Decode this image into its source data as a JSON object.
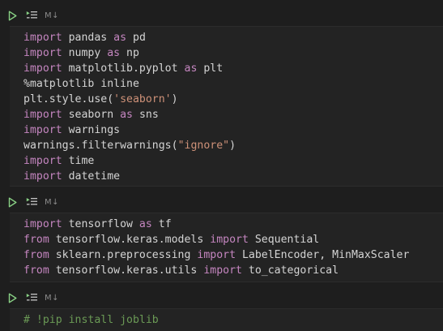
{
  "toolbar": {
    "markdown_label": "M↓"
  },
  "cells": [
    {
      "lines": [
        [
          {
            "k": "kw",
            "t": "import"
          },
          {
            "k": "tx",
            "t": " pandas "
          },
          {
            "k": "kw",
            "t": "as"
          },
          {
            "k": "tx",
            "t": " pd"
          }
        ],
        [
          {
            "k": "kw",
            "t": "import"
          },
          {
            "k": "tx",
            "t": " numpy "
          },
          {
            "k": "kw",
            "t": "as"
          },
          {
            "k": "tx",
            "t": " np"
          }
        ],
        [
          {
            "k": "kw",
            "t": "import"
          },
          {
            "k": "tx",
            "t": " matplotlib.pyplot "
          },
          {
            "k": "kw",
            "t": "as"
          },
          {
            "k": "tx",
            "t": " plt"
          }
        ],
        [
          {
            "k": "tx",
            "t": "%matplotlib inline"
          }
        ],
        [
          {
            "k": "tx",
            "t": "plt.style.use("
          },
          {
            "k": "str",
            "t": "'seaborn'"
          },
          {
            "k": "tx",
            "t": ")"
          }
        ],
        [
          {
            "k": "kw",
            "t": "import"
          },
          {
            "k": "tx",
            "t": " seaborn "
          },
          {
            "k": "kw",
            "t": "as"
          },
          {
            "k": "tx",
            "t": " sns"
          }
        ],
        [
          {
            "k": "kw",
            "t": "import"
          },
          {
            "k": "tx",
            "t": " warnings"
          }
        ],
        [
          {
            "k": "tx",
            "t": "warnings.filterwarnings("
          },
          {
            "k": "str",
            "t": "\"ignore\""
          },
          {
            "k": "tx",
            "t": ")"
          }
        ],
        [
          {
            "k": "kw",
            "t": "import"
          },
          {
            "k": "tx",
            "t": " time"
          }
        ],
        [
          {
            "k": "kw",
            "t": "import"
          },
          {
            "k": "tx",
            "t": " datetime"
          }
        ]
      ]
    },
    {
      "lines": [
        [
          {
            "k": "kw",
            "t": "import"
          },
          {
            "k": "tx",
            "t": " tensorflow "
          },
          {
            "k": "kw",
            "t": "as"
          },
          {
            "k": "tx",
            "t": " tf"
          }
        ],
        [
          {
            "k": "kw",
            "t": "from"
          },
          {
            "k": "tx",
            "t": " tensorflow.keras.models "
          },
          {
            "k": "kw",
            "t": "import"
          },
          {
            "k": "tx",
            "t": " Sequential"
          }
        ],
        [
          {
            "k": "kw",
            "t": "from"
          },
          {
            "k": "tx",
            "t": " sklearn.preprocessing "
          },
          {
            "k": "kw",
            "t": "import"
          },
          {
            "k": "tx",
            "t": " LabelEncoder, MinMaxScaler"
          }
        ],
        [
          {
            "k": "kw",
            "t": "from"
          },
          {
            "k": "tx",
            "t": " tensorflow.keras.utils "
          },
          {
            "k": "kw",
            "t": "import"
          },
          {
            "k": "tx",
            "t": " to_categorical"
          }
        ]
      ]
    },
    {
      "lines": [
        [
          {
            "k": "cm",
            "t": "# !pip install joblib"
          }
        ]
      ]
    }
  ]
}
